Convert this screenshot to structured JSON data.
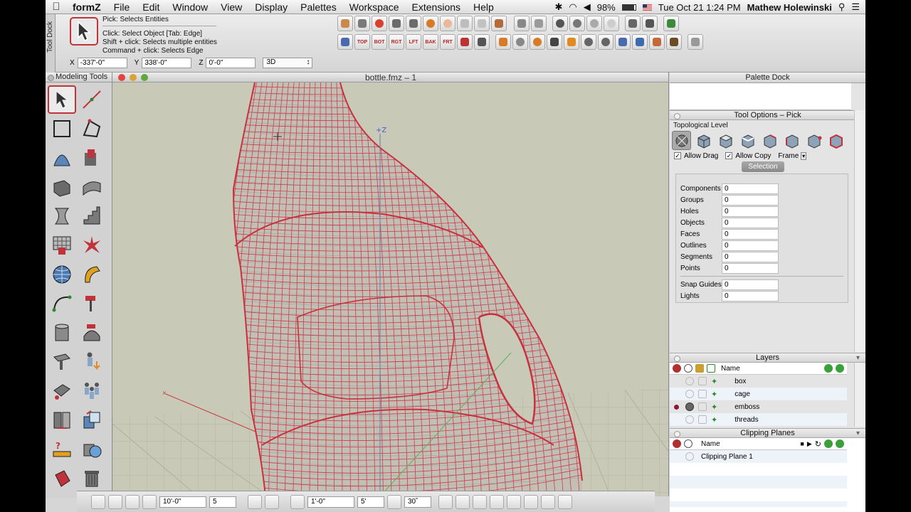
{
  "menubar": {
    "app": "formZ",
    "items": [
      "File",
      "Edit",
      "Window",
      "View",
      "Display",
      "Palettes",
      "Workspace",
      "Extensions",
      "Help"
    ],
    "battery": "98%",
    "datetime": "Tue Oct 21  1:24 PM",
    "user": "Mathew Holewinski"
  },
  "tooldock": {
    "label": "Tool Dock",
    "pick_title": "Pick:  Selects Entities",
    "help_lines": [
      "Click: Select Object [Tab: Edge]",
      "Shift + click: Selects multiple entities",
      "Command + click: Selects Edge"
    ]
  },
  "view_buttons": [
    "TOP",
    "BOT",
    "RGT",
    "LFT",
    "BAK",
    "FRT"
  ],
  "coords": {
    "x_label": "X",
    "x_value": "-337'-0\"",
    "y_label": "Y",
    "y_value": "338'-0\"",
    "z_label": "Z",
    "z_value": "0'-0\"",
    "mode": "3D"
  },
  "modeling_tools": {
    "title": "Modeling Tools"
  },
  "viewport": {
    "title": "bottle.fmz – 1",
    "axis_z": "+Z",
    "colors": {
      "background": "#c9c9b8",
      "wire": "#d23a48",
      "grid": "#b7b7a6"
    }
  },
  "statusbar": {
    "grid_size": "10'-0\"",
    "grid_divisions": "5",
    "snap_size": "1'-0\"",
    "snap_divisions": "5'",
    "angle": "30˚"
  },
  "palette_dock": {
    "title": "Palette Dock",
    "tool_options": {
      "title": "Tool Options – Pick",
      "topological_level": "Topological Level",
      "allow_drag": "Allow Drag",
      "allow_copy": "Allow Copy",
      "frame": "Frame",
      "selection_button": "Selection",
      "counts": [
        {
          "label": "Components",
          "value": "0"
        },
        {
          "label": "Groups",
          "value": "0"
        },
        {
          "label": "Holes",
          "value": "0"
        },
        {
          "label": "Objects",
          "value": "0"
        },
        {
          "label": "Faces",
          "value": "0"
        },
        {
          "label": "Outlines",
          "value": "0"
        },
        {
          "label": "Segments",
          "value": "0"
        },
        {
          "label": "Points",
          "value": "0"
        }
      ],
      "extra_counts": [
        {
          "label": "Snap Guides",
          "value": "0"
        },
        {
          "label": "Lights",
          "value": "0"
        }
      ]
    },
    "layers": {
      "title": "Layers",
      "name_header": "Name",
      "rows": [
        {
          "name": "box",
          "active": false
        },
        {
          "name": "cage",
          "active": false
        },
        {
          "name": "emboss",
          "active": true
        },
        {
          "name": "threads",
          "active": false
        }
      ]
    },
    "clipping": {
      "title": "Clipping Planes",
      "name_header": "Name",
      "rows": [
        {
          "name": "Clipping Plane 1"
        }
      ]
    }
  }
}
